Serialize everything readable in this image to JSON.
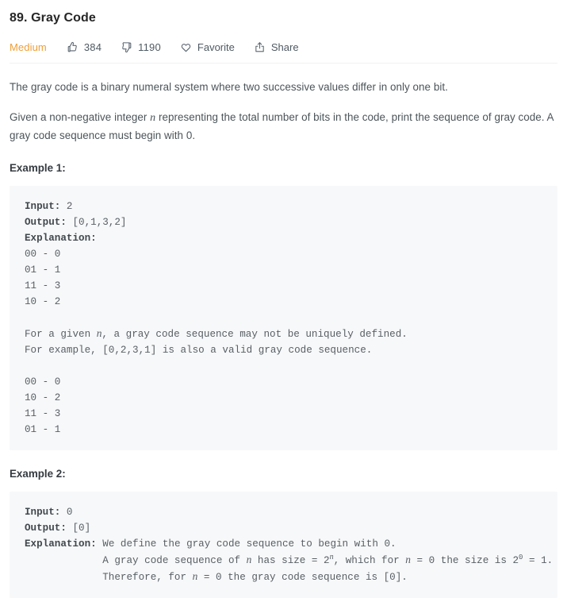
{
  "problem": {
    "title": "89. Gray Code",
    "difficulty": "Medium"
  },
  "meta": {
    "likes_icon": "thumbs-up-icon",
    "likes": "384",
    "dislikes_icon": "thumbs-down-icon",
    "dislikes": "1190",
    "favorite_icon": "heart-icon",
    "favorite_label": "Favorite",
    "share_icon": "share-icon",
    "share_label": "Share"
  },
  "colors": {
    "difficulty_medium": "#ef9f38",
    "code_background": "#f7f8f9",
    "body_text": "#4b5459",
    "title_text": "#262626",
    "divider": "#f1f2f4"
  },
  "description": {
    "paragraph_1": "The gray code is a binary numeral system where two successive values differ in only one bit.",
    "paragraph_2_part_1": "Given a non-negative integer ",
    "paragraph_2_var": "n",
    "paragraph_2_part_2": " representing the total number of bits in the code, print the sequence of gray code. A gray code sequence must begin with 0."
  },
  "examples": [
    {
      "heading": "Example 1:",
      "code": {
        "input_label": "Input:",
        "input_value": " 2",
        "output_label": "Output:",
        "output_value": " [0,1,3,2]",
        "explanation_label": "Explanation:",
        "lines_1": "00 - 0\n01 - 1\n11 - 3\n10 - 2\n",
        "note_part_1": "For a given ",
        "note_var": "n",
        "note_part_2": ", a gray code sequence may not be uniquely defined.\nFor example, [0,2,3,1] is also a valid gray code sequence.\n",
        "lines_2": "00 - 0\n10 - 2\n11 - 3\n01 - 1"
      }
    },
    {
      "heading": "Example 2:",
      "code": {
        "input_label": "Input:",
        "input_value": " 0",
        "output_label": "Output:",
        "output_value": " [0]",
        "explanation_label": "Explanation:",
        "explanation_line_1": " We define the gray code sequence to begin with 0.",
        "explanation_line_2_a": "             A gray code sequence of ",
        "explanation_line_2_var_1": "n",
        "explanation_line_2_b": " has size = 2",
        "explanation_line_2_sup_1": "n",
        "explanation_line_2_c": ", which for ",
        "explanation_line_2_var_2": "n",
        "explanation_line_2_d": " = 0 the size is 2",
        "explanation_line_2_sup_2": "0",
        "explanation_line_2_e": " = 1.",
        "explanation_line_3_a": "             Therefore, for ",
        "explanation_line_3_var": "n",
        "explanation_line_3_b": " = 0 the gray code sequence is [0]."
      }
    }
  ]
}
